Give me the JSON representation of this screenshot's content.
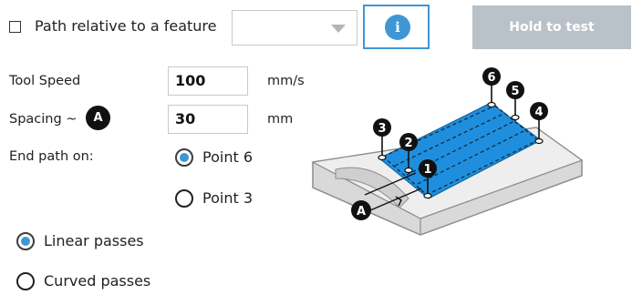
{
  "feature": {
    "checkbox_label": "Path relative to a feature",
    "checked": false,
    "dropdown_value": ""
  },
  "info_button": {
    "glyph": "i"
  },
  "hold_button": {
    "label": "Hold to test"
  },
  "tool_speed": {
    "label": "Tool Speed",
    "value": "100",
    "unit": "mm/s"
  },
  "spacing": {
    "label": "Spacing ~",
    "badge": "A",
    "value": "30",
    "unit": "mm"
  },
  "end_path": {
    "label": "End path on:",
    "options": [
      {
        "label": "Point 6",
        "selected": true
      },
      {
        "label": "Point 3",
        "selected": false
      }
    ]
  },
  "pass_type": {
    "options": [
      {
        "label": "Linear passes",
        "selected": true
      },
      {
        "label": "Curved passes",
        "selected": false
      }
    ]
  },
  "illustration": {
    "point_labels": [
      "1",
      "2",
      "3",
      "4",
      "5",
      "6"
    ],
    "spacing_marker": "A"
  },
  "colors": {
    "accent": "#3f96d4",
    "disabled_button": "#b9c1c9",
    "path_area": "#1f8fdd"
  }
}
